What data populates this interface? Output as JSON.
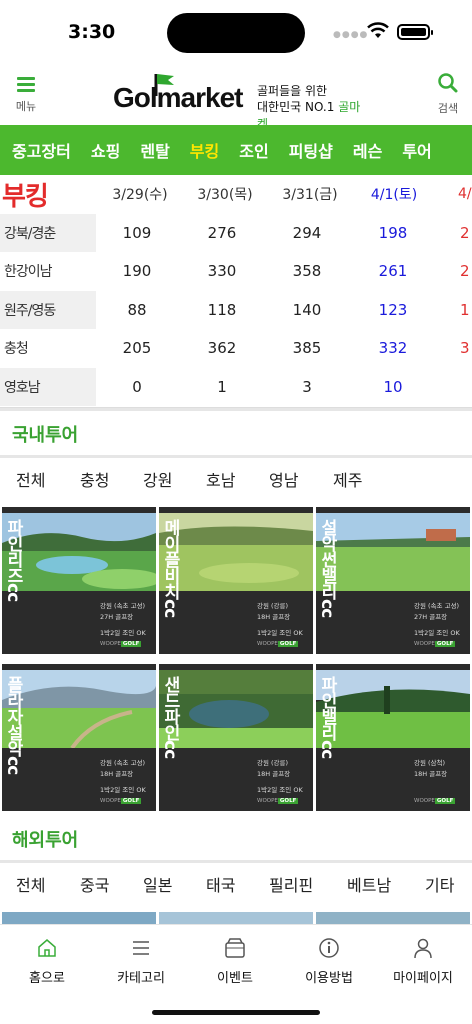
{
  "status": {
    "time": "3:30"
  },
  "header": {
    "menu_label": "메뉴",
    "logo_word": "Golmarket",
    "tagline_1": "골퍼들을 위한",
    "tagline_2a": "대한민국 NO.1 ",
    "tagline_2b": "골마켓",
    "search_label": "검색"
  },
  "categories": [
    {
      "label": "중고장터"
    },
    {
      "label": "쇼핑"
    },
    {
      "label": "렌탈"
    },
    {
      "label": "부킹"
    },
    {
      "label": "조인"
    },
    {
      "label": "피팅샵"
    },
    {
      "label": "레슨"
    },
    {
      "label": "투어"
    }
  ],
  "booking": {
    "title": "부킹",
    "dates": [
      "3/29(수)",
      "3/30(목)",
      "3/31(금)",
      "4/1(토)",
      "4/"
    ],
    "rows": [
      {
        "region": "강북/경춘",
        "values": [
          "109",
          "276",
          "294",
          "198",
          "2"
        ]
      },
      {
        "region": "한강이남",
        "values": [
          "190",
          "330",
          "358",
          "261",
          "2"
        ]
      },
      {
        "region": "원주/영동",
        "values": [
          "88",
          "118",
          "140",
          "123",
          "1"
        ]
      },
      {
        "region": "충청",
        "values": [
          "205",
          "362",
          "385",
          "332",
          "3"
        ]
      },
      {
        "region": "영호남",
        "values": [
          "0",
          "1",
          "3",
          "10",
          ""
        ]
      }
    ]
  },
  "domestic_tour": {
    "title": "국내투어",
    "tabs": [
      "전체",
      "충청",
      "강원",
      "호남",
      "영남",
      "제주"
    ],
    "cards": [
      {
        "name": "파인리즈cc",
        "region": "강원 (속초 고성)",
        "holes": "27H 골프장",
        "note": "1박2일 조인 OK"
      },
      {
        "name": "메이플비치cc",
        "region": "강원 (강릉)",
        "holes": "18H 골프장",
        "note": "1박2일 조인 OK"
      },
      {
        "name": "설악썬밸리cc",
        "region": "강원 (속초 고성)",
        "holes": "27H 골프장",
        "note": "1박2일 조인 OK"
      },
      {
        "name": "플라자설악cc",
        "region": "강원 (속초 고성)",
        "holes": "18H 골프장",
        "note": "1박2일 조인 OK"
      },
      {
        "name": "샌드파인cc",
        "region": "강원 (강릉)",
        "holes": "18H 골프장",
        "note": "1박2일 조인 OK"
      },
      {
        "name": "파인밸리cc",
        "region": "강원 (삼척)",
        "holes": "18H 골프장",
        "note": ""
      }
    ],
    "brand_a": "WOOPE",
    "brand_b": "GOLF"
  },
  "overseas_tour": {
    "title": "해외투어",
    "tabs": [
      "전체",
      "중국",
      "일본",
      "태국",
      "필리핀",
      "베트남",
      "기타"
    ]
  },
  "bottom_nav": [
    {
      "label": "홈으로",
      "icon": "home-icon"
    },
    {
      "label": "카테고리",
      "icon": "list-icon"
    },
    {
      "label": "이벤트",
      "icon": "event-box-icon"
    },
    {
      "label": "이용방법",
      "icon": "info-icon"
    },
    {
      "label": "마이페이지",
      "icon": "person-icon"
    }
  ],
  "colors": {
    "brand_green": "#4cb82e",
    "active_yellow": "#ffe600",
    "booking_red": "#e32b2b",
    "saturday_blue": "#1a1adb"
  }
}
